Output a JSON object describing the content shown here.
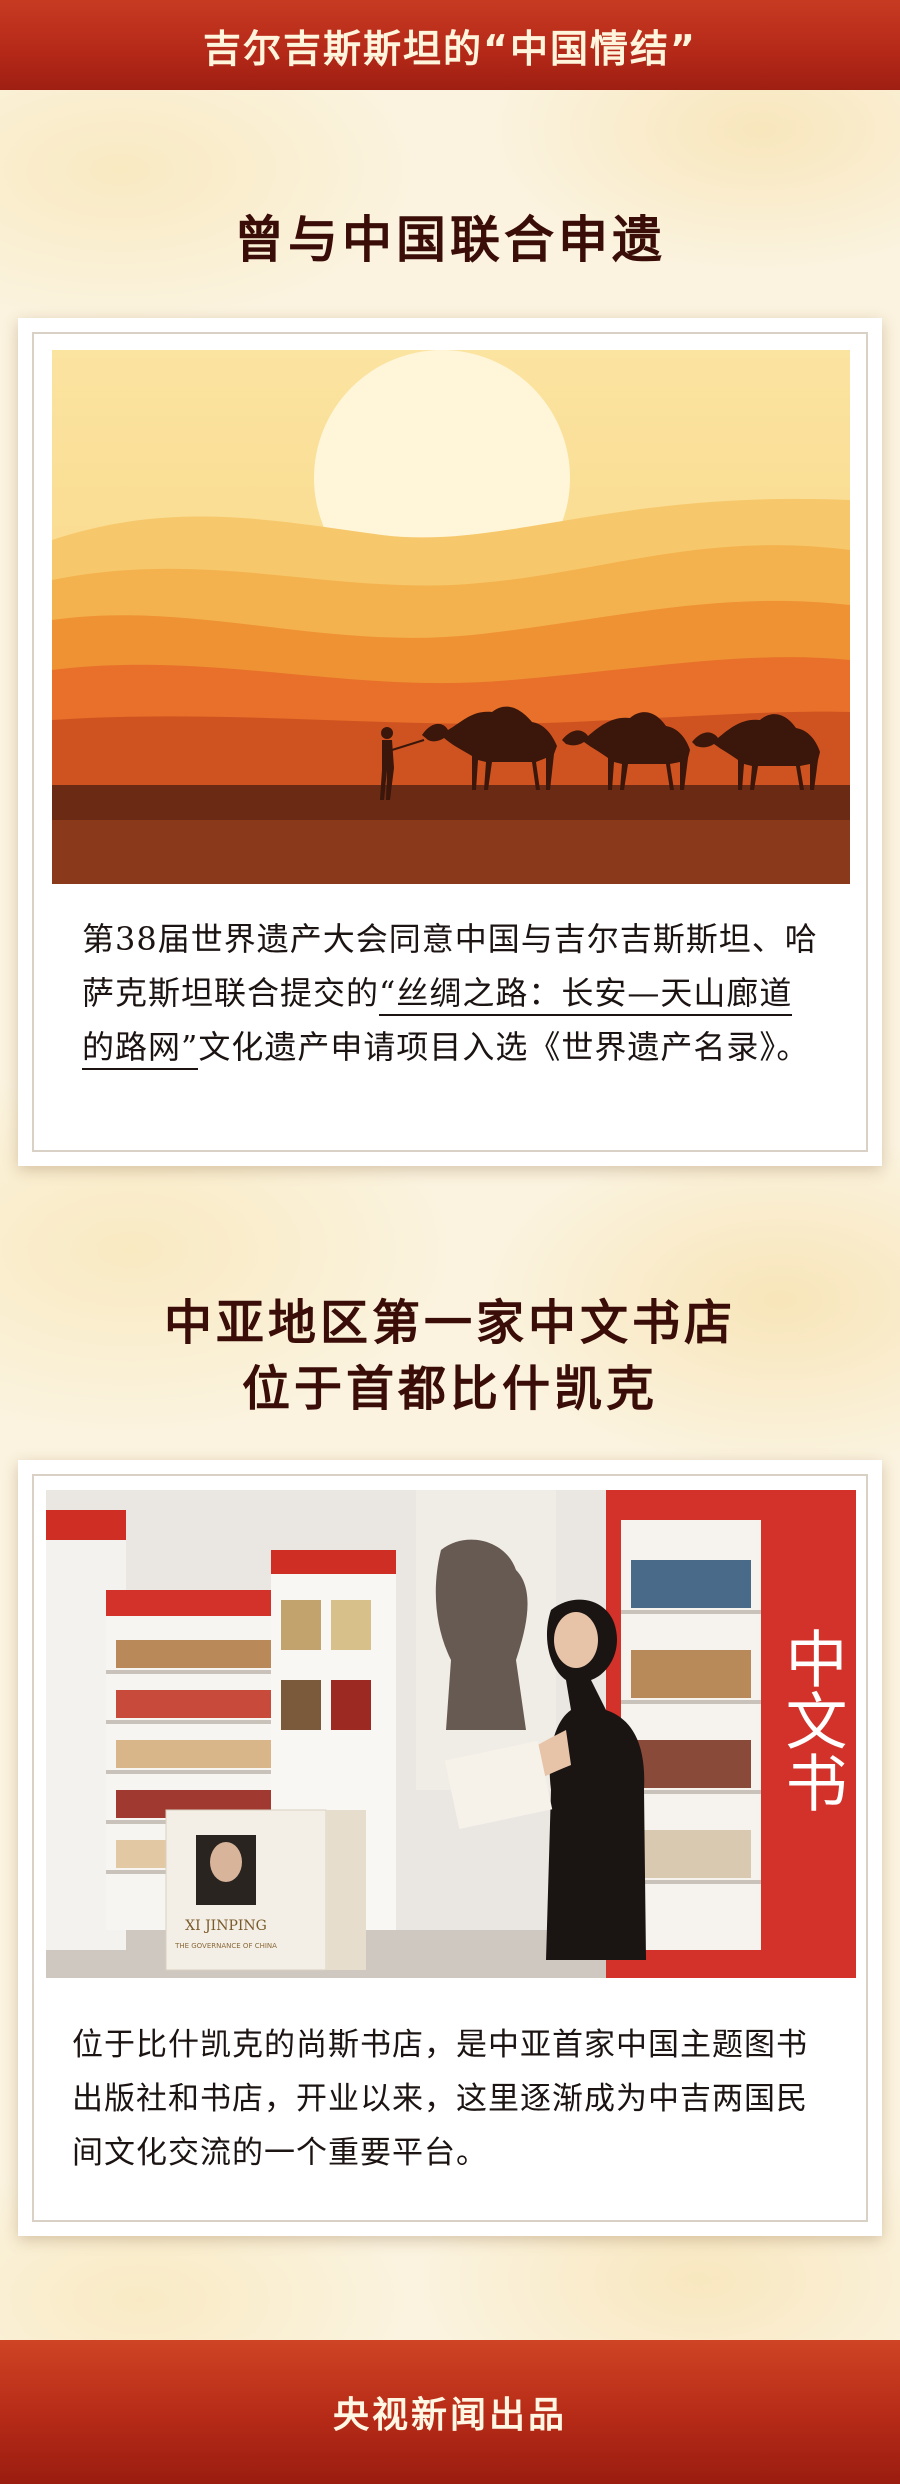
{
  "header": {
    "title": "吉尔吉斯斯坦的“中国情结”"
  },
  "section1": {
    "heading": "曾与中国联合申遗",
    "caption_pre": "第38届世界遗产大会同意中国与吉尔吉斯斯坦、哈萨克斯坦联合提交的",
    "caption_highlight": "“丝绸之路：长安—天山廊道的路网”",
    "caption_post": "文化遗产申请项目入选《世界遗产名录》。"
  },
  "section2": {
    "heading_line1": "中亚地区第一家中文书店",
    "heading_line2": "位于首都比什凯克",
    "photo_sign": "中文书",
    "book_title": "XI JINPING",
    "book_subtitle": "THE GOVERNANCE OF CHINA",
    "caption": "位于比什凯克的尚斯书店，是中亚首家中国主题图书出版社和书店，开业以来，这里逐渐成为中吉两国民间文化交流的一个重要平台。"
  },
  "footer": {
    "credit": "央视新闻出品"
  },
  "colors": {
    "banner_red": "#b42818",
    "heading_dark": "#3a0d08",
    "paper": "#fbf3df",
    "sunset_orange": "#e8702a",
    "bookshelf_red": "#d2322a"
  }
}
